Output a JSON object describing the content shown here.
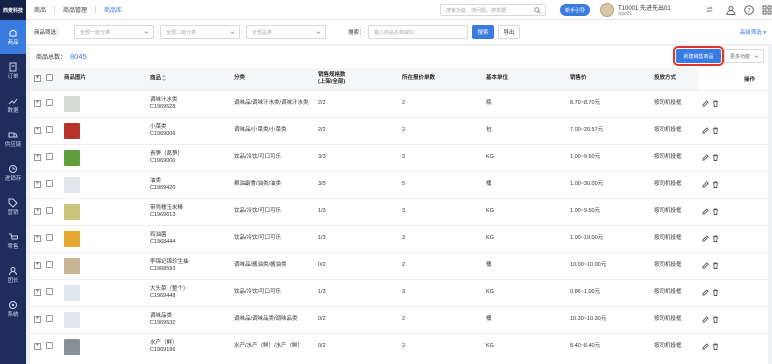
{
  "sidebar": {
    "logo": "西麦科技",
    "items": [
      {
        "label": "商品",
        "icon": "goods-icon",
        "active": true
      },
      {
        "label": "订单",
        "icon": "order-icon",
        "active": false
      },
      {
        "label": "数据",
        "icon": "chart-icon",
        "active": false
      },
      {
        "label": "供应链",
        "icon": "supply-chain-icon",
        "active": false
      },
      {
        "label": "进销存",
        "icon": "inventory-icon",
        "active": false
      },
      {
        "label": "营销",
        "icon": "tag-icon",
        "active": false
      },
      {
        "label": "零售",
        "icon": "cart-icon",
        "active": false
      },
      {
        "label": "团长",
        "icon": "leader-icon",
        "active": false
      },
      {
        "label": "系统",
        "icon": "settings-icon",
        "active": false
      }
    ]
  },
  "topbar": {
    "tabs": [
      "商品",
      "商品管理",
      "商品库"
    ],
    "search_placeholder": "搜索功能、搜问题、搜单据",
    "guide_label": "新手引导",
    "user_name": "T10001 先进先出01",
    "user_id": "xjxc01"
  },
  "filter": {
    "category_label": "商品筛选：",
    "cat1_placeholder": "全部一级分类",
    "cat2_placeholder": "全部二级分类",
    "brand_placeholder": "全部品类",
    "search_label": "搜索：",
    "search_placeholder": "输入商品名称或ID",
    "search_button": "搜索",
    "export_button": "导出",
    "advanced_label": "高级筛选"
  },
  "panel": {
    "count_label": "商品总数：",
    "count_value": "8045",
    "new_button": "新建销售商品",
    "more_button": "更多功能"
  },
  "table": {
    "headers": [
      "商品图片",
      "商品",
      "分类",
      "销售规格数\n(上架/全部)",
      "所在报价单数",
      "基本单位",
      "销售价",
      "投放方式",
      "操作"
    ],
    "rows": [
      {
        "name": "调味汁水类",
        "code": "C1969528",
        "category": "调味品/调味汁水类/调味汁水类",
        "specs": "2/2",
        "quotes": "2",
        "unit": "瓶",
        "price": "8.70~8.70元",
        "delivery": "按司机投框",
        "thumb": "#d9dcd2"
      },
      {
        "name": "小菜类",
        "code": "C1969006",
        "category": "调味品/小菜类/小菜类",
        "specs": "2/2",
        "quotes": "2",
        "unit": "包",
        "price": "7.00~20.57元",
        "delivery": "按司机投框",
        "thumb": "#b8322a"
      },
      {
        "name": "青笋（莴笋）",
        "code": "C1969000",
        "category": "饮品/冷饮/可口可乐",
        "specs": "3/3",
        "quotes": "3",
        "unit": "KG",
        "price": "1.00~9.60元",
        "delivery": "按司机投框",
        "thumb": "#5f9e3a"
      },
      {
        "name": "油类",
        "code": "C1969420",
        "category": "粮油副食/油类/油类",
        "specs": "3/5",
        "quotes": "5",
        "unit": "桶",
        "price": "1.00~30.00元",
        "delivery": "按司机投框",
        "thumb": "#dfe6ee"
      },
      {
        "name": "带壳糯玉米棒",
        "code": "C1969613",
        "category": "饮品/冷饮/可口可乐",
        "specs": "1/3",
        "quotes": "3",
        "unit": "KG",
        "price": "1.00~9.50元",
        "delivery": "按司机投框",
        "thumb": "#c8c47a"
      },
      {
        "name": "鸡油菌",
        "code": "C1968444",
        "category": "饮品/冷饮/可口可乐",
        "specs": "1/3",
        "quotes": "3",
        "unit": "KG",
        "price": "1.00~19.00元",
        "delivery": "按司机投框",
        "thumb": "#e4a82e"
      },
      {
        "name": "李锦记锦珍生抽",
        "code": "C1968593",
        "category": "调味品/酱油类/酱油类",
        "specs": "0/2",
        "quotes": "2",
        "unit": "桶",
        "price": "10.00~10.00元",
        "delivery": "按司机投框",
        "thumb": "#c9b594"
      },
      {
        "name": "大头菜（整个）",
        "code": "C1969448",
        "category": "饮品/冷饮/可口可乐",
        "specs": "1/3",
        "quotes": "3",
        "unit": "KG",
        "price": "0.86~1.00元",
        "delivery": "按司机投框",
        "thumb": "#dfe6ee"
      },
      {
        "name": "调味品类",
        "code": "C1969532",
        "category": "调味品/调味品类/调味品类",
        "specs": "0/2",
        "quotes": "2",
        "unit": "桶",
        "price": "10.30~10.30元",
        "delivery": "按司机投框",
        "thumb": "#dfe6ee"
      },
      {
        "name": "水产（鲜）",
        "code": "C1969196",
        "category": "水产/水产（鲜）/水产（鲜）",
        "specs": "0/2",
        "quotes": "2",
        "unit": "KG",
        "price": "8.40~8.40元",
        "delivery": "按司机投框",
        "thumb": "#8a8f98"
      }
    ]
  },
  "colors": {
    "accent": "#3a7be0",
    "sidebar": "#1f2d5c",
    "highlight": "#e0352b"
  }
}
